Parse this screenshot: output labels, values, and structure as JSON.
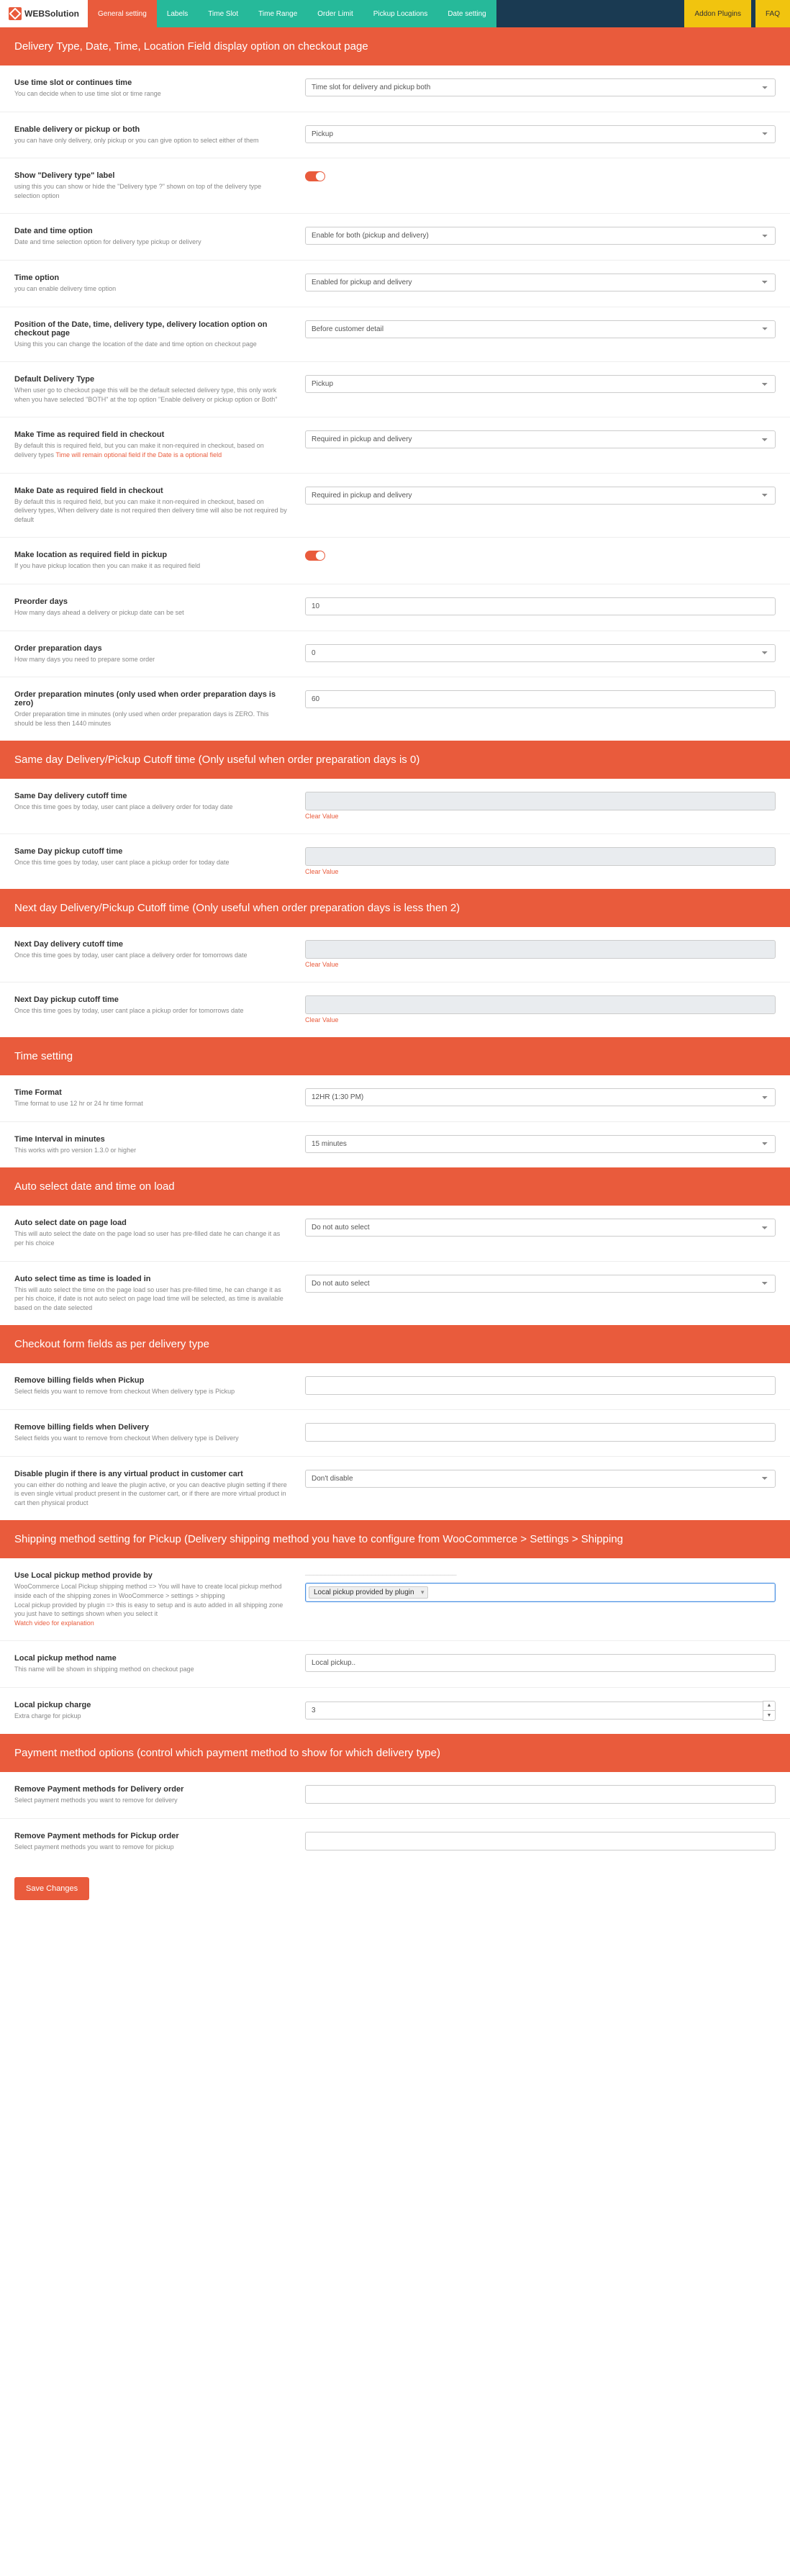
{
  "nav": {
    "logo_text": "WEBSolution",
    "items": [
      "General setting",
      "Labels",
      "Time Slot",
      "Time Range",
      "Order Limit",
      "Pickup Locations",
      "Date setting"
    ],
    "addon": "Addon Plugins",
    "faq": "FAQ"
  },
  "sections": {
    "s1": "Delivery Type, Date, Time, Location Field display option on checkout page",
    "s2": "Same day Delivery/Pickup Cutoff time (Only useful when order preparation days is 0)",
    "s3": "Next day Delivery/Pickup Cutoff time (Only useful when order preparation days is less then 2)",
    "s4": "Time setting",
    "s5": "Auto select date and time on load",
    "s6": "Checkout form fields as per delivery type",
    "s7": "Shipping method setting for Pickup (Delivery shipping method you have to configure from WooCommerce > Settings > Shipping",
    "s8": "Payment method options (control which payment method to show for which delivery type)"
  },
  "fields": {
    "use_time_slot": {
      "title": "Use time slot or continues time",
      "desc": "You can decide when to use time slot or time range",
      "value": "Time slot for delivery and pickup both"
    },
    "enable_delivery": {
      "title": "Enable delivery or pickup or both",
      "desc": "you can have only delivery, only pickup or you can give option to select either of them",
      "value": "Pickup"
    },
    "show_label": {
      "title": "Show \"Delivery type\" label",
      "desc": "using this you can show or hide the \"Delivery type ?\" shown on top of the delivery type selection option"
    },
    "date_time_opt": {
      "title": "Date and time option",
      "desc": "Date and time selection option for delivery type pickup or delivery",
      "value": "Enable for both (pickup and delivery)"
    },
    "time_opt": {
      "title": "Time option",
      "desc": "you can enable delivery time option",
      "value": "Enabled for pickup and delivery"
    },
    "position": {
      "title": "Position of the Date, time, delivery type, delivery location option on checkout page",
      "desc": "Using this you can change the location of the date and time option on checkout page",
      "value": "Before customer detail"
    },
    "default_type": {
      "title": "Default Delivery Type",
      "desc": "When user go to checkout page this will be the default selected delivery type, this only work when you have selected \"BOTH\" at the top option \"Enable delivery or pickup option or Both\"",
      "value": "Pickup"
    },
    "make_time_req": {
      "title": "Make Time as required field in checkout",
      "desc": "By default this is required field, but you can make it non-required in checkout, based on delivery types ",
      "desc_red": "Time will remain optional field if the Date is a optional field",
      "value": "Required in pickup and delivery"
    },
    "make_date_req": {
      "title": "Make Date as required field in checkout",
      "desc": "By default this is required field, but you can make it non-required in checkout, based on delivery types, When delivery date is not required then delivery time will also be not required by default",
      "value": "Required in pickup and delivery"
    },
    "make_loc_req": {
      "title": "Make location as required field in pickup",
      "desc": "If you have pickup location then you can make it as required field"
    },
    "preorder": {
      "title": "Preorder days",
      "desc": "How many days ahead a delivery or pickup date can be set",
      "value": "10"
    },
    "prep_days": {
      "title": "Order preparation days",
      "desc": "How many days you need to prepare some order",
      "value": "0"
    },
    "prep_min": {
      "title": "Order preparation minutes (only used when order preparation days is zero)",
      "desc": "Order preparation time in minutes (only used when order preparation days is ZERO. This should be less then 1440 minutes",
      "value": "60"
    },
    "same_del_cut": {
      "title": "Same Day delivery cutoff time",
      "desc": "Once this time goes by today, user cant place a delivery order for today date",
      "clear": "Clear Value"
    },
    "same_pick_cut": {
      "title": "Same Day pickup cutoff time",
      "desc": "Once this time goes by today, user cant place a pickup order for today date",
      "clear": "Clear Value"
    },
    "next_del_cut": {
      "title": "Next Day delivery cutoff time",
      "desc": "Once this time goes by today, user cant place a delivery order for tomorrows date",
      "clear": "Clear Value"
    },
    "next_pick_cut": {
      "title": "Next Day pickup cutoff time",
      "desc": "Once this time goes by today, user cant place a pickup order for tomorrows date",
      "clear": "Clear Value"
    },
    "time_format": {
      "title": "Time Format",
      "desc": "Time format to use 12 hr or 24 hr time format",
      "value": "12HR (1:30 PM)"
    },
    "time_interval": {
      "title": "Time Interval in minutes",
      "desc": "This works with pro version 1.3.0 or higher",
      "value": "15 minutes"
    },
    "auto_date": {
      "title": "Auto select date on page load",
      "desc": "This will auto select the date on the page load so user has pre-filled date he can change it as per his choice",
      "value": "Do not auto select"
    },
    "auto_time": {
      "title": "Auto select time as time is loaded in",
      "desc": "This will auto select the time on the page load so user has pre-filled time, he can change it as per his choice, if date is not auto select on page load time will be selected, as time is available based on the date selected",
      "value": "Do not auto select"
    },
    "rm_bill_pickup": {
      "title": "Remove billing fields when Pickup",
      "desc": "Select fields you want to remove from checkout When delivery type is Pickup"
    },
    "rm_bill_delivery": {
      "title": "Remove billing fields when Delivery",
      "desc": "Select fields you want to remove from checkout When delivery type is Delivery"
    },
    "disable_virtual": {
      "title": "Disable plugin if there is any virtual product in customer cart",
      "desc": "you can either do nothing and leave the plugin active, or you can deactive plugin setting if there is even single virtual product present in the customer cart, or if there are more virtual product in cart then physical product",
      "value": "Don't disable"
    },
    "use_local_pickup": {
      "title": "Use Local pickup method provide by",
      "desc": "WooCommerce Local Pickup shipping method => You will have to create local pickup method inside each of the shipping zones in WooCommerce > settings > shipping ",
      "desc2": "Local pickup provided by plugin => this is easy to setup and is auto added in all shipping zone you just have to settings shown when you select it",
      "link": "Watch video for explanation",
      "value": "Local pickup provided by plugin",
      "hint_line": "───────────────────────────────────────"
    },
    "local_name": {
      "title": "Local pickup method name",
      "desc": "This name will be shown in shipping method on checkout page",
      "value": "Local pickup.."
    },
    "local_charge": {
      "title": "Local pickup charge",
      "desc": "Extra charge for pickup",
      "value": "3"
    },
    "rm_pay_del": {
      "title": "Remove Payment methods for Delivery order",
      "desc": "Select payment methods you want to remove for delivery"
    },
    "rm_pay_pick": {
      "title": "Remove Payment methods for Pickup order",
      "desc": "Select payment methods you want to remove for pickup"
    }
  },
  "save": "Save Changes"
}
